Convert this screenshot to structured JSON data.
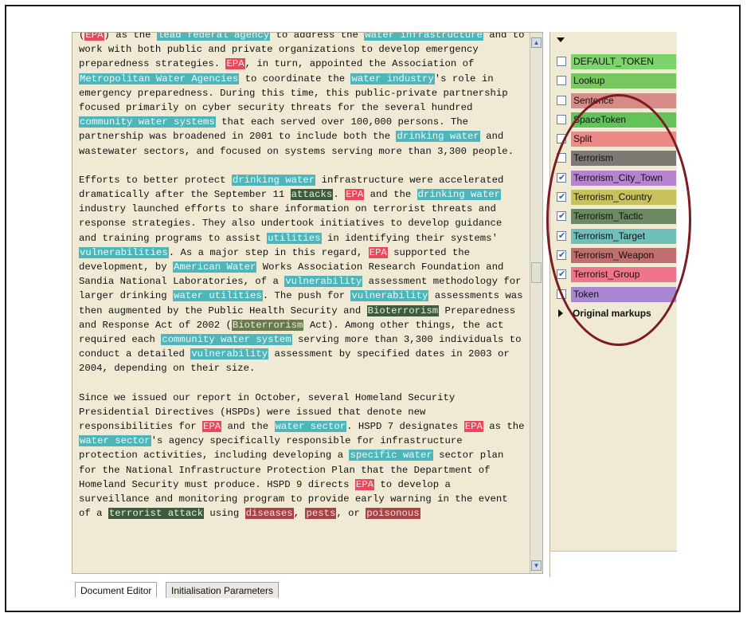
{
  "document": {
    "paragraphs": [
      [
        {
          "t": "",
          "type": "red",
          "label": "EPA"
        },
        {
          "t": ") as the "
        },
        {
          "type": "teal",
          "label": "lead federal agency"
        },
        {
          "t": " to address the "
        },
        {
          "type": "teal",
          "label": "water infrastructure"
        },
        {
          "t": " and to work with both public and private organizations to develop emergency preparedness strategies. "
        },
        {
          "type": "red",
          "label": "EPA"
        },
        {
          "t": ", in turn, appointed the Association of "
        },
        {
          "type": "teal",
          "label": "Metropolitan Water Agencies"
        },
        {
          "t": " to coordinate the "
        },
        {
          "type": "teal",
          "label": "water industry"
        },
        {
          "t": "'s role in emergency preparedness. During this time, this public-private partnership focused primarily on cyber security threats for the several hundred "
        },
        {
          "type": "teal",
          "label": "community water systems"
        },
        {
          "t": " that each served over 100,000 persons. The partnership was broadened in 2001 to include both the "
        },
        {
          "type": "teal",
          "label": "drinking water"
        },
        {
          "t": " and wastewater sectors, and focused on systems serving more than 3,300 people."
        }
      ],
      [
        {
          "t": "Efforts to better protect "
        },
        {
          "type": "teal",
          "label": "drinking water"
        },
        {
          "t": " infrastructure were accelerated dramatically after the September 11 "
        },
        {
          "type": "dark",
          "label": "attacks"
        },
        {
          "t": ". "
        },
        {
          "type": "red",
          "label": "EPA"
        },
        {
          "t": " and the "
        },
        {
          "type": "teal",
          "label": "drinking water"
        },
        {
          "t": " industry launched efforts to share information on terrorist threats and response strategies. They also undertook initiatives to develop guidance and training programs to assist "
        },
        {
          "type": "teal",
          "label": "utilities"
        },
        {
          "t": " in identifying their systems' "
        },
        {
          "type": "teal",
          "label": "vulnerabilities"
        },
        {
          "t": ". As a major step in this regard, "
        },
        {
          "type": "red",
          "label": "EPA"
        },
        {
          "t": " supported the development, by "
        },
        {
          "type": "teal",
          "label": "American Water"
        },
        {
          "t": " Works Association Research Foundation and Sandia National Laboratories, of a "
        },
        {
          "type": "teal",
          "label": "vulnerability"
        },
        {
          "t": " assessment methodology for larger drinking "
        },
        {
          "type": "teal",
          "label": "water utilities"
        },
        {
          "t": ". The push for "
        },
        {
          "type": "teal",
          "label": "vulnerability"
        },
        {
          "t": " assessments was then augmented by the Public Health Security and "
        },
        {
          "type": "dark",
          "label": "Bioterrorism"
        },
        {
          "t": " Preparedness and Response Act of 2002 ("
        },
        {
          "type": "olive",
          "label": "Bioterrorism"
        },
        {
          "t": " Act). Among other things, the act required each "
        },
        {
          "type": "teal",
          "label": "community water system"
        },
        {
          "t": " serving more than 3,300 individuals to conduct a detailed "
        },
        {
          "type": "teal",
          "label": "vulnerability"
        },
        {
          "t": " assessment by specified dates in 2003 or 2004, depending on their size."
        }
      ],
      [
        {
          "t": "Since we issued our report in October, several Homeland Security Presidential Directives (HSPDs) were issued that denote new responsibilities for "
        },
        {
          "type": "red",
          "label": "EPA"
        },
        {
          "t": " and the "
        },
        {
          "type": "teal",
          "label": "water sector"
        },
        {
          "t": ". HSPD 7 designates "
        },
        {
          "type": "red",
          "label": "EPA"
        },
        {
          "t": " as the "
        },
        {
          "type": "teal",
          "label": "water sector"
        },
        {
          "t": "'s agency specifically responsible for infrastructure protection activities, including developing a "
        },
        {
          "type": "teal",
          "label": "specific water"
        },
        {
          "t": " sector plan for the National Infrastructure Protection Plan that the Department of Homeland Security must produce. HSPD 9 directs "
        },
        {
          "type": "red",
          "label": "EPA"
        },
        {
          "t": " to develop a surveillance and monitoring program to provide early warning in the event of a "
        },
        {
          "type": "dark",
          "label": "terrorist attack"
        },
        {
          "t": " using "
        },
        {
          "type": "weapon",
          "label": "diseases"
        },
        {
          "t": ", "
        },
        {
          "type": "weapon",
          "label": "pests"
        },
        {
          "t": ", or "
        },
        {
          "type": "weapon",
          "label": "poisonous"
        }
      ]
    ],
    "first_prefix": "("
  },
  "annotation_sets": {
    "items": [
      {
        "label": "DEFAULT_TOKEN",
        "checked": false,
        "color": "#7fd36b"
      },
      {
        "label": "Lookup",
        "checked": false,
        "color": "#78c65e"
      },
      {
        "label": "Sentence",
        "checked": false,
        "color": "#d88b86"
      },
      {
        "label": "SpaceToken",
        "checked": false,
        "color": "#64c25a"
      },
      {
        "label": "Split",
        "checked": false,
        "color": "#ee8a86"
      },
      {
        "label": "Terrorism",
        "checked": false,
        "color": "#7c7a72"
      },
      {
        "label": "Terrorism_City_Town",
        "checked": true,
        "color": "#b583cf"
      },
      {
        "label": "Terrorism_Country",
        "checked": true,
        "color": "#c8c25c"
      },
      {
        "label": "Terrorism_Tactic",
        "checked": true,
        "color": "#6b8a62"
      },
      {
        "label": "Terrorism_Target",
        "checked": true,
        "color": "#6fc0b9"
      },
      {
        "label": "Terrorism_Weapon",
        "checked": true,
        "color": "#c26e6e"
      },
      {
        "label": "Terrorist_Group",
        "checked": true,
        "color": "#f0758a"
      },
      {
        "label": "Token",
        "checked": false,
        "color": "#a986d2"
      }
    ],
    "original_markups": "Original markups"
  },
  "tabs": {
    "document_editor": "Document Editor",
    "initialisation_parameters": "Initialisation Parameters"
  }
}
